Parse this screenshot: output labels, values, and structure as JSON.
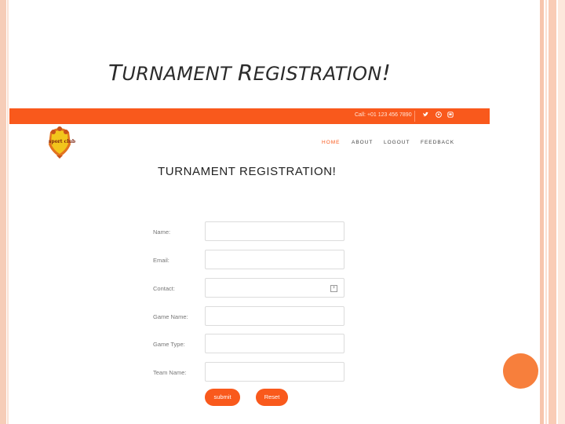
{
  "slide": {
    "title_first_cap": "T",
    "title_rest_1": "URNAMENT ",
    "title_second_cap": "R",
    "title_rest_2": "EGISTRATION",
    "title_end": "!"
  },
  "site": {
    "topbar": {
      "phone": "Call: +01 123 456 7890",
      "social_icons": [
        "twitter-icon",
        "pinterest-icon",
        "instagram-icon"
      ]
    },
    "logo_text": "sport club",
    "nav": [
      "HOME",
      "ABOUT",
      "LOGOUT",
      "FEEDBACK"
    ],
    "active_nav": "HOME",
    "form_title": "TURNAMENT REGISTRATION!",
    "fields": [
      {
        "label": "Name:",
        "value": ""
      },
      {
        "label": "Email:",
        "value": ""
      },
      {
        "label": "Contact:",
        "value": ""
      },
      {
        "label": "Game Name:",
        "value": ""
      },
      {
        "label": "Game Type:",
        "value": ""
      },
      {
        "label": "Team Name:",
        "value": ""
      }
    ],
    "buttons": {
      "submit": "submit",
      "reset": "Reset"
    }
  },
  "colors": {
    "brand_orange": "#f9591c",
    "accent_circle": "#f77f3c"
  }
}
